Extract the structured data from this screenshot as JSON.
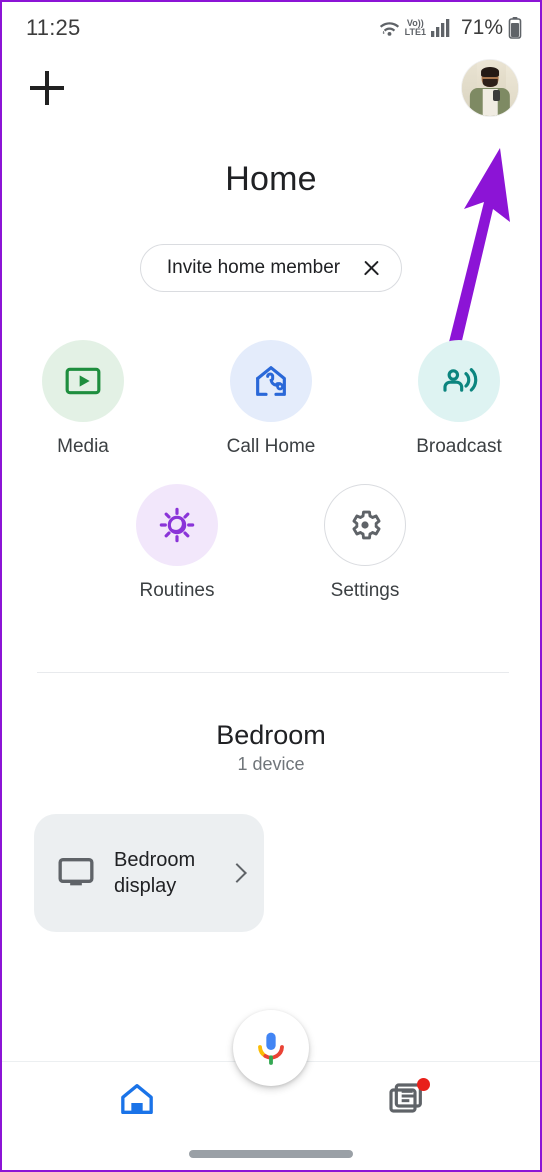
{
  "status_bar": {
    "time": "11:25",
    "battery_percent": "71%",
    "network_label": "LTE1",
    "volte_label": "Vo))",
    "icons": [
      "wifi-icon",
      "volte-icon",
      "cellular-signal-icon",
      "battery-icon"
    ]
  },
  "app_bar": {
    "add_label": "+",
    "add_name": "plus-icon",
    "avatar_name": "account-avatar"
  },
  "annotation": {
    "arrow_color": "#8c14d6",
    "points_to": "account-avatar"
  },
  "header": {
    "title": "Home"
  },
  "invite_chip": {
    "label": "Invite home member",
    "close_icon": "close-icon"
  },
  "quick_actions": {
    "row1": [
      {
        "label": "Media",
        "icon": "media-play-icon",
        "circle_color": "#e3f1e5",
        "icon_color": "#1e8e3e"
      },
      {
        "label": "Call Home",
        "icon": "call-home-icon",
        "circle_color": "#e4ecfb",
        "icon_color": "#2a68d8"
      },
      {
        "label": "Broadcast",
        "icon": "broadcast-icon",
        "circle_color": "#def3f2",
        "icon_color": "#0c857f"
      }
    ],
    "row2": [
      {
        "label": "Routines",
        "icon": "routines-sun-icon",
        "circle_color": "#f2e7fb",
        "icon_color": "#8a34d8"
      },
      {
        "label": "Settings",
        "icon": "gear-icon",
        "circle_color": "#ffffff",
        "icon_color": "#5f6368"
      }
    ]
  },
  "room": {
    "name": "Bedroom",
    "device_count": "1 device",
    "devices": [
      {
        "name": "Bedroom display",
        "icon": "display-icon",
        "chevron": "chevron-right-icon"
      }
    ]
  },
  "assistant_fab": {
    "icon": "google-assistant-mic-icon",
    "colors": {
      "blue": "#4285f4",
      "red": "#ea4335",
      "yellow": "#fbbc05",
      "green": "#34a853"
    }
  },
  "bottom_nav": [
    {
      "label": "Home",
      "icon": "home-icon",
      "active": true,
      "badge": false
    },
    {
      "label": "Feed",
      "icon": "feed-icon",
      "active": false,
      "badge": true
    }
  ]
}
